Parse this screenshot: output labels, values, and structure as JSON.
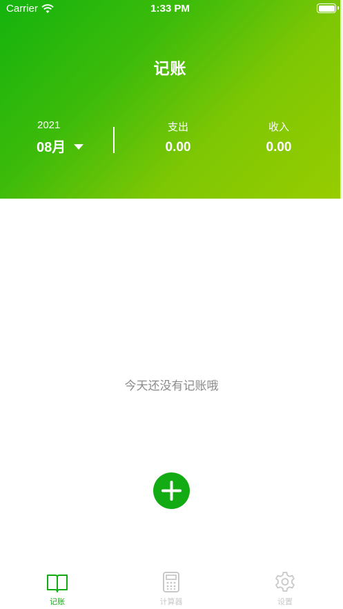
{
  "status_bar": {
    "carrier": "Carrier",
    "time": "1:33 PM"
  },
  "header": {
    "title": "记账",
    "year": "2021",
    "month": "08月",
    "expense": {
      "label": "支出",
      "value": "0.00"
    },
    "income": {
      "label": "收入",
      "value": "0.00"
    }
  },
  "main": {
    "empty_message": "今天还没有记账哦"
  },
  "tabs": [
    {
      "label": "记账",
      "icon": "book-icon",
      "active": true
    },
    {
      "label": "计算器",
      "icon": "calculator-icon",
      "active": false
    },
    {
      "label": "设置",
      "icon": "gear-icon",
      "active": false
    }
  ],
  "colors": {
    "accent": "#13ab14",
    "gradient_start": "#14b30e",
    "gradient_end": "#97cc00",
    "muted_text": "#8a8a8a",
    "inactive": "#c8c8c8"
  }
}
